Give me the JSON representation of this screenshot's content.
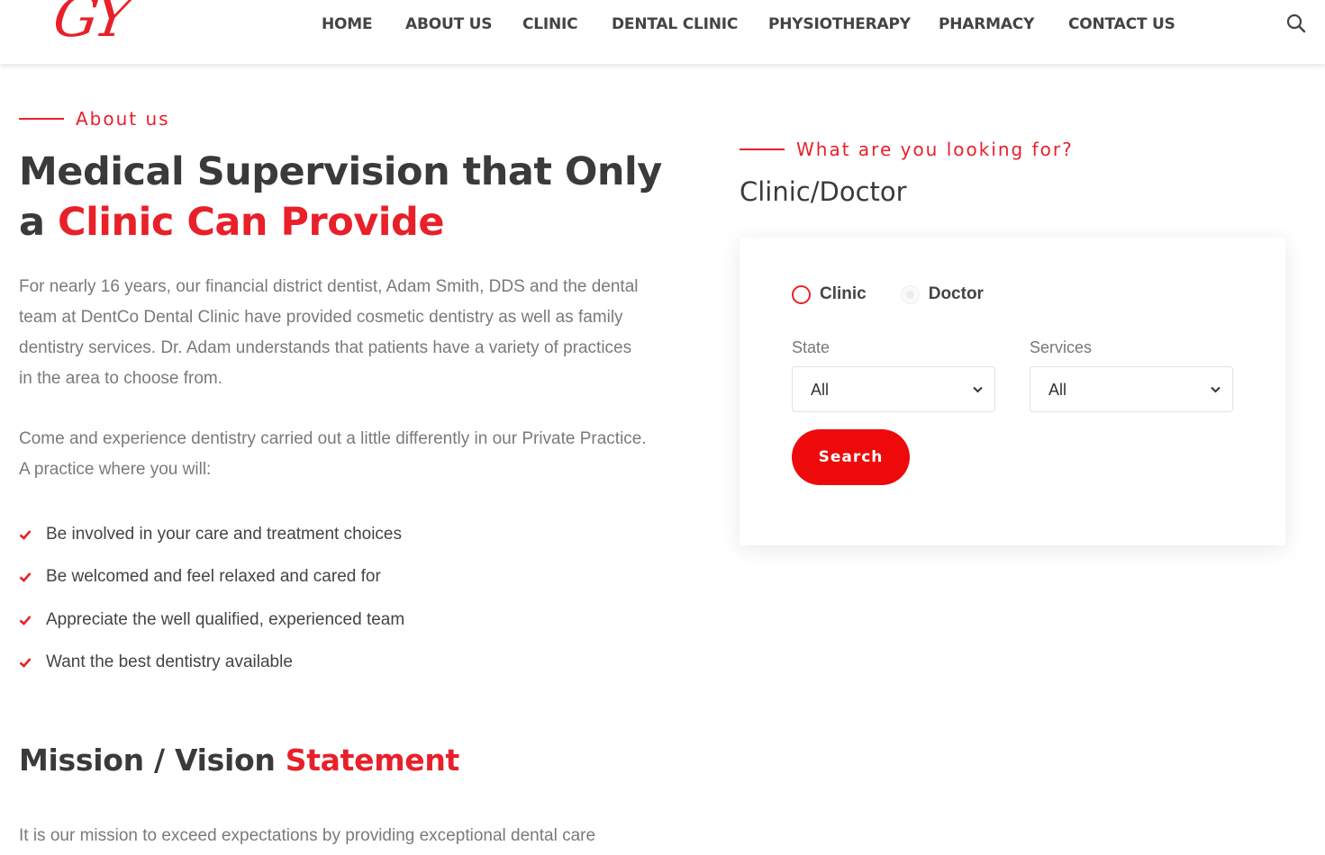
{
  "header": {
    "logo_text": "GY",
    "nav": [
      "HOME",
      "ABOUT US",
      "CLINIC",
      "DENTAL CLINIC",
      "PHYSIOTHERAPY",
      "PHARMACY",
      "CONTACT US"
    ]
  },
  "about": {
    "eyebrow": "About us",
    "heading_part1": "Medical Supervision that Only a",
    "heading_highlight": "Clinic Can Provide",
    "paragraph1": "For nearly 16 years, our financial district dentist, Adam Smith, DDS and the dental team at DentCo Dental Clinic have provided cosmetic dentistry as well as family dentistry services. Dr. Adam understands that patients have a variety of practices in the area to choose from.",
    "paragraph2": "Come and experience dentistry carried out a little differently in our Private Practice. A practice where you will:",
    "list": [
      "Be involved in your care and treatment choices",
      "Be welcomed and feel relaxed and cared for",
      "Appreciate the well qualified, experienced team",
      "Want the best dentistry available"
    ]
  },
  "mission": {
    "heading_part1": "Mission / Vision",
    "heading_highlight": "Statement",
    "paragraph": "It is our mission to exceed expectations by providing exceptional dental care"
  },
  "finder": {
    "eyebrow": "What are you looking for?",
    "title": "Clinic/Doctor",
    "radio_clinic": "Clinic",
    "radio_doctor": "Doctor",
    "selected": "Clinic",
    "state_label": "State",
    "state_value": "All",
    "services_label": "Services",
    "services_value": "All",
    "search_label": "Search"
  },
  "colors": {
    "accent": "#e8202a",
    "button": "#ee0a0a",
    "heading": "#3a3a3a",
    "body_text": "#7a7a7a"
  }
}
